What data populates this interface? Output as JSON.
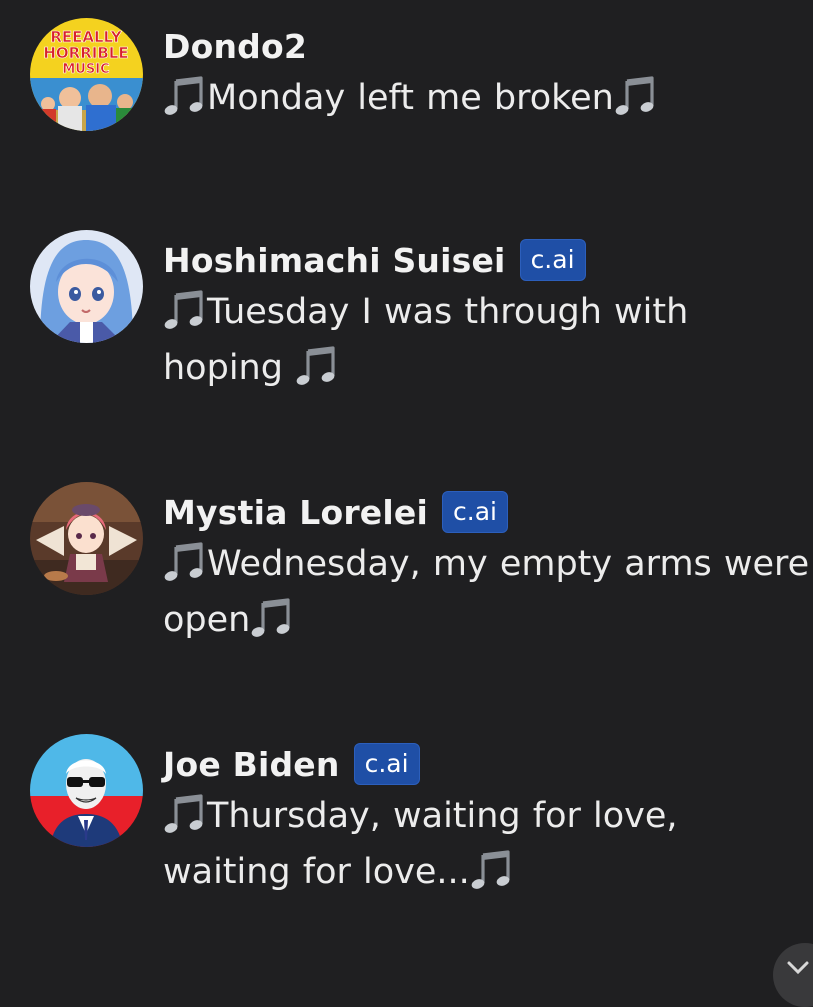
{
  "messages": [
    {
      "author": "Dondo2",
      "badge": "",
      "avatar_icon": "reeally-horrible-music-avatar",
      "avatar_text": [
        "REEALLY",
        "HORRIBLE",
        "MUSIC"
      ],
      "text": "Monday left me broken"
    },
    {
      "author": "Hoshimachi Suisei",
      "badge": "c.ai",
      "avatar_icon": "anime-girl-blue-hair-avatar",
      "text": "Tuesday I was through with hoping "
    },
    {
      "author": "Mystia Lorelei",
      "badge": "c.ai",
      "avatar_icon": "anime-bird-girl-avatar",
      "text": "Wednesday, my empty arms were open"
    },
    {
      "author": "Joe Biden",
      "badge": "c.ai",
      "avatar_icon": "sunglasses-man-avatar",
      "text": "Thursday, waiting for love, waiting for love..."
    }
  ],
  "colors": {
    "background": "#1f1f21",
    "badge": "#1f4fa6",
    "text": "#ececec"
  }
}
